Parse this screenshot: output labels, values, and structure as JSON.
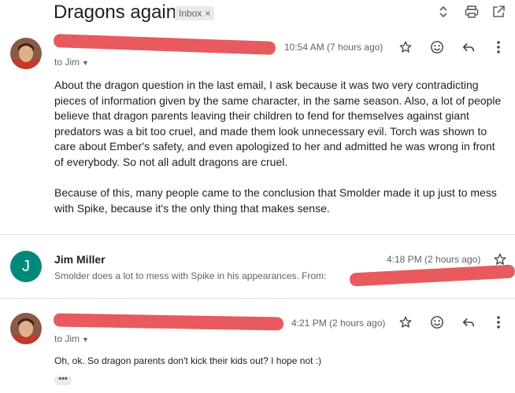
{
  "thread": {
    "subject": "Dragons again",
    "label": "Inbox",
    "label_remove": "×"
  },
  "header_icons": [
    "expand-collapse-icon",
    "print-icon",
    "open-in-new-window-icon"
  ],
  "messages": [
    {
      "time": "10:54 AM (7 hours ago)",
      "to": "to Jim",
      "paragraphs": [
        "About the dragon question in the last email, I ask because it was two very contradicting pieces of information given by the same character, in the same season. Also, a lot of people believe that dragon parents leaving their children to fend for themselves against giant predators was a bit too cruel, and made them look unnecessary evil. Torch was shown to care about Ember's safety, and even apologized to her and admitted he was wrong in front of everybody. So not all adult dragons are cruel.",
        "Because of this, many people came to the conclusion that Smolder made it up just to mess with Spike, because it's the only thing that makes sense."
      ]
    },
    {
      "sender": "Jim Miller",
      "avatar_letter": "J",
      "avatar_color": "#00897b",
      "time": "4:18 PM (2 hours ago)",
      "snippet": "Smolder does a lot to mess with Spike in his appearances. From:"
    },
    {
      "time": "4:21 PM (2 hours ago)",
      "to": "to Jim",
      "body": "Oh, ok. So dragon parents don't kick their kids out? I hope not :)",
      "ellipsis": "•••"
    }
  ],
  "colors": {
    "redaction": "#e85a5d",
    "avatar_teal": "#00897b",
    "icon_gray": "#5f6368"
  }
}
